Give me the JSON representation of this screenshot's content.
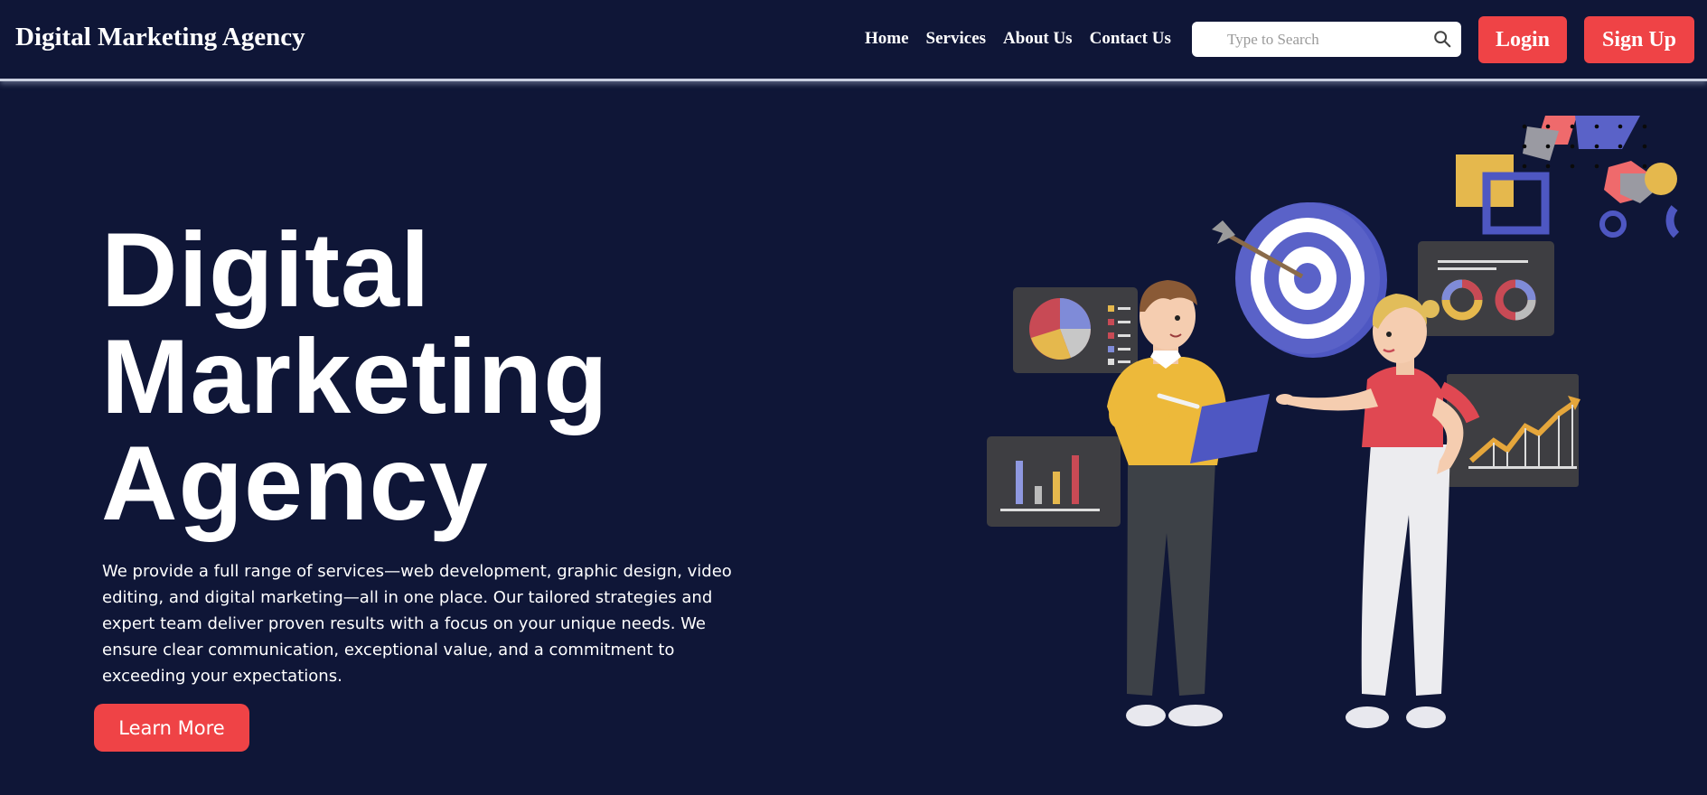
{
  "header": {
    "brand": "Digital Marketing Agency",
    "nav": [
      "Home",
      "Services",
      "About Us",
      "Contact Us"
    ],
    "search": {
      "placeholder": "Type to Search",
      "icon": "search-icon"
    },
    "login_label": "Login",
    "signup_label": "Sign Up"
  },
  "hero": {
    "title_lines": [
      "Digital",
      "Marketing",
      "Agency"
    ],
    "description": "We provide a full range of services—web development, graphic design, video editing, and digital marketing—all in one place. Our tailored strategies and expert team deliver proven results with a focus on your unique needs. We ensure clear communication, exceptional value, and a commitment to exceeding your expectations.",
    "cta_label": "Learn More"
  },
  "colors": {
    "background": "#0f1637",
    "accent": "#ef4346",
    "text": "#ffffff"
  }
}
